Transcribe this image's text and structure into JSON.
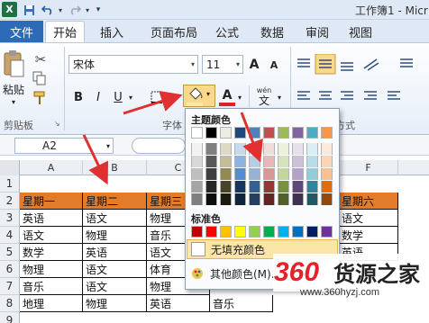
{
  "title_bar": {
    "window_title": "工作簿1 - Micr",
    "logo": "X"
  },
  "tabs": {
    "file": "文件",
    "home": "开始",
    "insert": "插入",
    "layout": "页面布局",
    "formulas": "公式",
    "data": "数据",
    "review": "审阅",
    "view": "视图"
  },
  "ribbon": {
    "paste_label": "粘贴",
    "clipboard_label": "剪贴板",
    "font_name": "宋体",
    "font_size": "11",
    "bold": "B",
    "italic": "I",
    "underline": "U",
    "grow_font": "A",
    "shrink_font": "A",
    "font_color_letter": "A",
    "wen": "wén",
    "wen_char": "文",
    "font_group_label": "字体",
    "align_group_label": "方式",
    "fill_color": "#fde9a2",
    "font_color": "#e02020"
  },
  "formula_bar": {
    "name_box": "A2"
  },
  "columns": [
    "A",
    "B",
    "C",
    "F"
  ],
  "rows": [
    "1",
    "2",
    "3",
    "4",
    "5",
    "6",
    "7",
    "8",
    "9"
  ],
  "grid": {
    "row2": [
      "星期一",
      "星期二",
      "星期三"
    ],
    "row2_f": "星期六",
    "body": [
      [
        "英语",
        "语文",
        "物理"
      ],
      [
        "语文",
        "物理",
        "音乐"
      ],
      [
        "数学",
        "英语",
        "语文"
      ],
      [
        "物理",
        "语文",
        "体育"
      ],
      [
        "音乐",
        "语文",
        "物理"
      ],
      [
        "地理",
        "物理",
        "英语",
        "音乐"
      ]
    ],
    "f_col": [
      "语文",
      "数学",
      "英语"
    ]
  },
  "palette": {
    "theme_label": "主题颜色",
    "standard_label": "标准色",
    "no_fill": "无填充颜色",
    "more_colors": "其他颜色(M)...",
    "theme_top": [
      "#ffffff",
      "#000000",
      "#eeece1",
      "#1f497d",
      "#4f81bd",
      "#c0504d",
      "#9bbb59",
      "#8064a2",
      "#4bacc6",
      "#f79646"
    ],
    "theme_shades": [
      [
        "#f2f2f2",
        "#7f7f7f",
        "#ddd9c3",
        "#c6d9f0",
        "#dbe5f1",
        "#f2dcdb",
        "#ebf1dd",
        "#e5e0ec",
        "#dbeef3",
        "#fdeada"
      ],
      [
        "#d8d8d8",
        "#595959",
        "#c4bd97",
        "#8db3e2",
        "#b8cce4",
        "#e5b9b7",
        "#d7e3bc",
        "#ccc1d9",
        "#b7dde8",
        "#fbd5b5"
      ],
      [
        "#bfbfbf",
        "#3f3f3f",
        "#938953",
        "#548dd4",
        "#95b3d7",
        "#d99694",
        "#c3d69b",
        "#b2a2c7",
        "#92cddc",
        "#fac08f"
      ],
      [
        "#a5a5a5",
        "#262626",
        "#494429",
        "#17365d",
        "#366092",
        "#953734",
        "#76923c",
        "#5f497a",
        "#31859b",
        "#e36c09"
      ],
      [
        "#7f7f7f",
        "#0c0c0c",
        "#1d1b10",
        "#0f243e",
        "#244061",
        "#632423",
        "#4f6128",
        "#3f3151",
        "#205867",
        "#974806"
      ]
    ],
    "standard": [
      "#c00000",
      "#ff0000",
      "#ffc000",
      "#ffff00",
      "#92d050",
      "#00b050",
      "#00b0f0",
      "#0070c0",
      "#002060",
      "#7030a0"
    ]
  },
  "brand": {
    "number": "360",
    "name": "货源之家",
    "url": "www.360hyzj.com"
  }
}
